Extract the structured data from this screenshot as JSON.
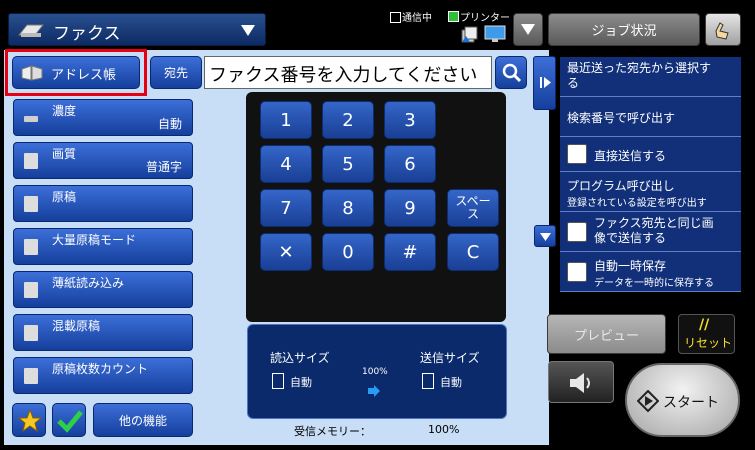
{
  "header": {
    "mode_title": "ファクス",
    "status_comm": "通信中",
    "status_printer": "プリンター",
    "job_status_label": "ジョブ状況"
  },
  "address": {
    "address_book_label": "アドレス帳",
    "recipient_label": "宛先",
    "fax_number_placeholder": "ファクス番号を入力してください"
  },
  "left_menu": [
    {
      "label": "濃度",
      "value": "自動"
    },
    {
      "label": "画質",
      "value": "普通字"
    },
    {
      "label": "原稿",
      "value": ""
    },
    {
      "label": "大量原稿モード",
      "value": ""
    },
    {
      "label": "薄紙読み込み",
      "value": ""
    },
    {
      "label": "混載原稿",
      "value": ""
    },
    {
      "label": "原稿枚数カウント",
      "value": ""
    }
  ],
  "bottom_left": {
    "other_functions_label": "他の機能"
  },
  "keypad": {
    "keys": [
      "1",
      "2",
      "3",
      "4",
      "5",
      "6",
      "7",
      "8",
      "9",
      "✕",
      "0",
      "#"
    ],
    "space_label": "スペース",
    "clear_label": "C"
  },
  "size_panel": {
    "scan_size_label": "読込サイズ",
    "scan_size_value": "自動",
    "ratio": "100%",
    "send_size_label": "送信サイズ",
    "send_size_value": "自動"
  },
  "memory": {
    "label": "受信メモリー：",
    "value": "100%"
  },
  "right_panel": {
    "recent_label": "最近送った宛先から選択する",
    "search_label": "検索番号で呼び出す",
    "direct_send_label": "直接送信する",
    "program_title": "プログラム呼び出し",
    "program_sub": "登録されている設定を呼び出す",
    "same_image_label": "ファクス宛先と同じ画像で送信する",
    "auto_save_title": "自動一時保存",
    "auto_save_sub": "データを一時的に保存する"
  },
  "actions": {
    "preview_label": "プレビュー",
    "reset_label": "リセット",
    "onhook_label": "オンフック",
    "start_label": "スタート"
  }
}
